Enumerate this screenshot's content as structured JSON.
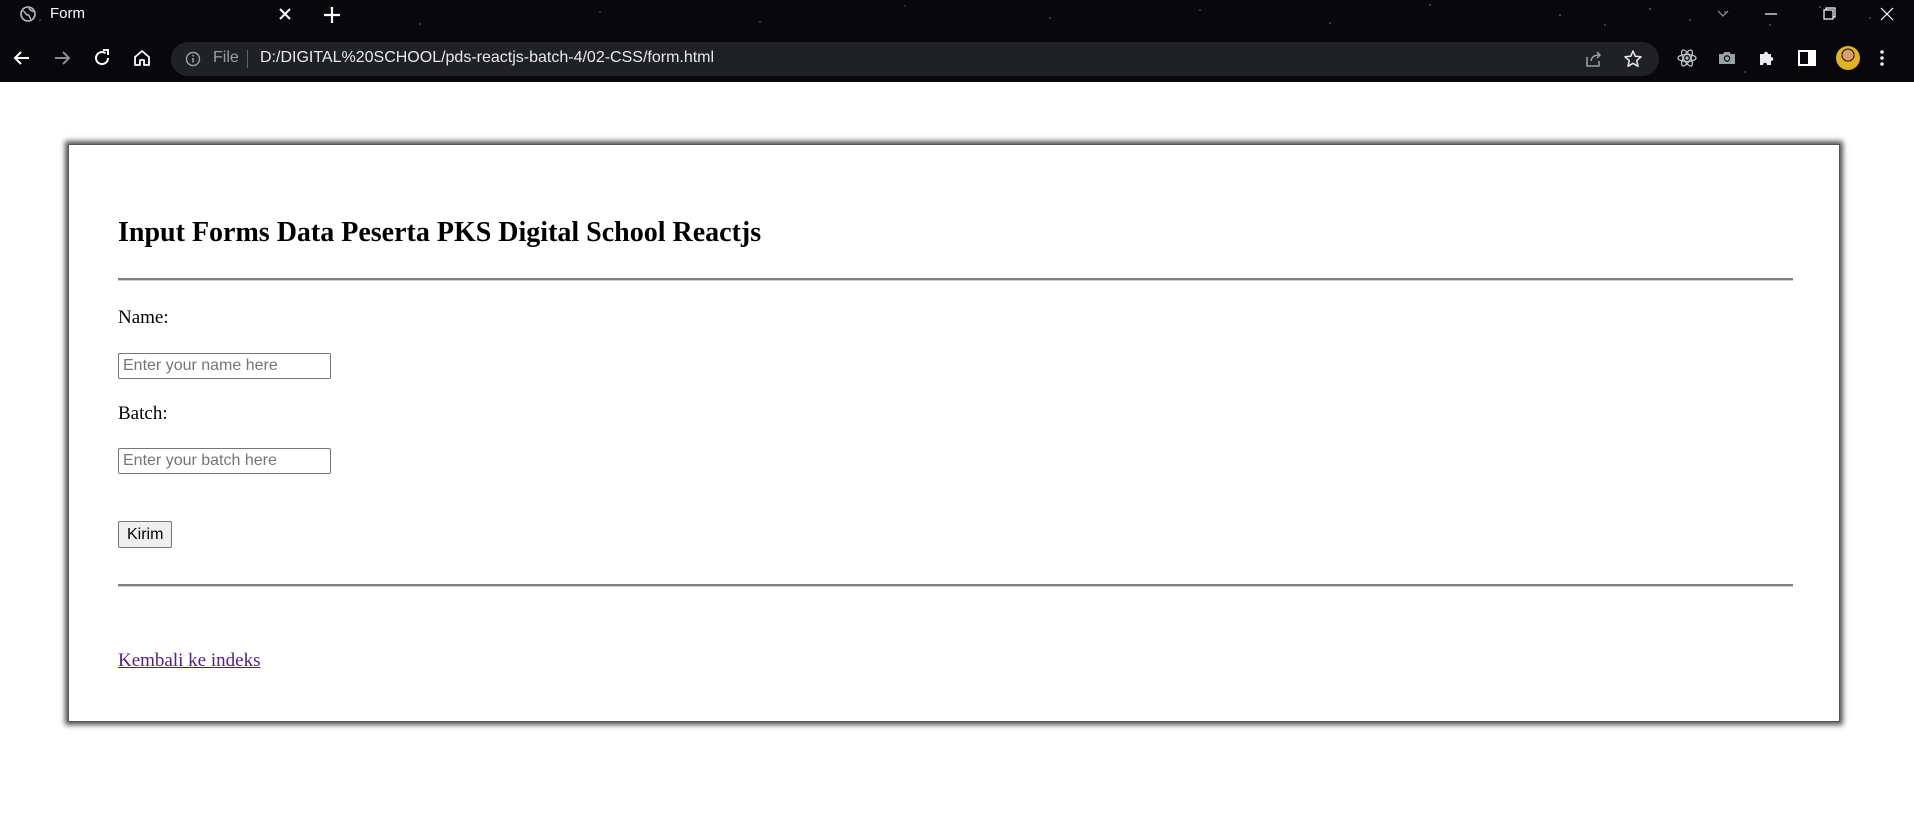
{
  "browser": {
    "tab_title": "Form",
    "omnibox_scheme_label": "File",
    "url": "D:/DIGITAL%20SCHOOL/pds-reactjs-batch-4/02-CSS/form.html",
    "icons": [
      "globe-icon",
      "close-icon",
      "plus-icon",
      "chevron-down-icon",
      "minimize-icon",
      "restore-icon",
      "close-window-icon",
      "back-arrow-icon",
      "forward-arrow-icon",
      "reload-icon",
      "home-icon",
      "info-icon",
      "share-icon",
      "star-icon",
      "react-devtools-icon",
      "camera-icon",
      "puzzle-icon",
      "side-panel-icon",
      "avatar",
      "kebab-menu-icon"
    ]
  },
  "page": {
    "heading": "Input Forms Data Peserta PKS Digital School Reactjs",
    "form": {
      "name_label": "Name:",
      "name_placeholder": "Enter your name here",
      "name_value": "",
      "batch_label": "Batch:",
      "batch_placeholder": "Enter your batch here",
      "batch_value": "",
      "submit_label": "Kirim"
    },
    "back_link": "Kembali ke indeks"
  }
}
